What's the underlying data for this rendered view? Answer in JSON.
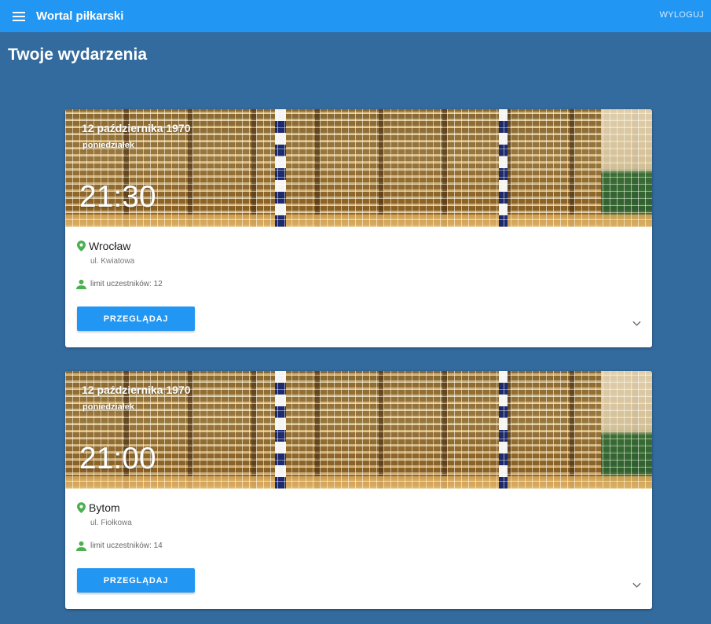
{
  "header": {
    "app_title": "Wortal piłkarski",
    "logout_label": "WYLOGUJ",
    "menu_icon": "hamburger-menu-icon"
  },
  "page": {
    "title": "Twoje wydarzenia"
  },
  "events": [
    {
      "date": "12 października 1970",
      "weekday": "poniedziałek",
      "time": "21:30",
      "city": "Wrocław",
      "street": "ul. Kwiatowa",
      "limit": "limit uczestników: 12",
      "button_label": "PRZEGLĄDAJ"
    },
    {
      "date": "12 października 1970",
      "weekday": "poniedziałek",
      "time": "21:00",
      "city": "Bytom",
      "street": "ul. Fiołkowa",
      "limit": "limit uczestników: 14",
      "button_label": "PRZEGLĄDAJ"
    }
  ],
  "colors": {
    "toolbar": "#2196f3",
    "background": "#336b9e",
    "button": "#2196f3",
    "icon_green": "#4caf50"
  }
}
